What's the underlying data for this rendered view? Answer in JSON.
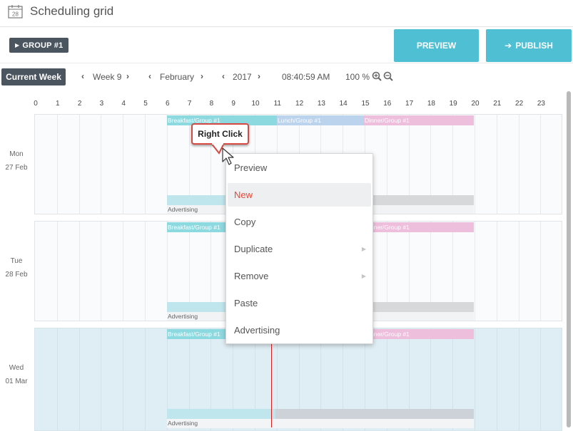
{
  "header": {
    "title": "Scheduling grid",
    "calendar_day": "28"
  },
  "toolbar": {
    "group_label": "GROUP #1",
    "preview_label": "PREVIEW",
    "publish_label": "PUBLISH",
    "current_week_label": "Current Week",
    "week": "Week 9",
    "month": "February",
    "year": "2017",
    "time": "08:40:59 AM",
    "zoom": "100 %"
  },
  "hours": [
    "0",
    "1",
    "2",
    "3",
    "4",
    "5",
    "6",
    "7",
    "8",
    "9",
    "10",
    "11",
    "12",
    "13",
    "14",
    "15",
    "16",
    "17",
    "18",
    "19",
    "20",
    "21",
    "22",
    "23"
  ],
  "days": [
    {
      "weekday": "Mon",
      "date": "27 Feb",
      "breakfast": "Breakfast/Group #1",
      "lunch": "Lunch/Group #1",
      "dinner": "Dinner/Group #1",
      "advertising": "Advertising"
    },
    {
      "weekday": "Tue",
      "date": "28 Feb",
      "breakfast": "Breakfast/Group #1",
      "lunch": "",
      "dinner": "Dinner/Group #1",
      "advertising": "Advertising"
    },
    {
      "weekday": "Wed",
      "date": "01 Mar",
      "breakfast": "Breakfast/Group #1",
      "lunch": "",
      "dinner": "Dinner/Group #1",
      "advertising": "Advertising"
    }
  ],
  "context_menu": {
    "items": [
      {
        "label": "Preview",
        "submenu": false,
        "highlighted": false
      },
      {
        "label": "New",
        "submenu": false,
        "highlighted": true
      },
      {
        "label": "Copy",
        "submenu": false,
        "highlighted": false
      },
      {
        "label": "Duplicate",
        "submenu": true,
        "highlighted": false
      },
      {
        "label": "Remove",
        "submenu": true,
        "highlighted": false
      },
      {
        "label": "Paste",
        "submenu": false,
        "highlighted": false
      },
      {
        "label": "Advertising",
        "submenu": false,
        "highlighted": false
      }
    ]
  },
  "callout": {
    "text": "Right Click"
  },
  "colors": {
    "accent": "#4fbfd4",
    "dark_button": "#4b5560",
    "breakfast": "#8dd9e0",
    "lunch": "#bcd3ee",
    "dinner": "#eebfdd",
    "highlight_text": "#e24b3b",
    "now_line": "#d91e1e"
  }
}
